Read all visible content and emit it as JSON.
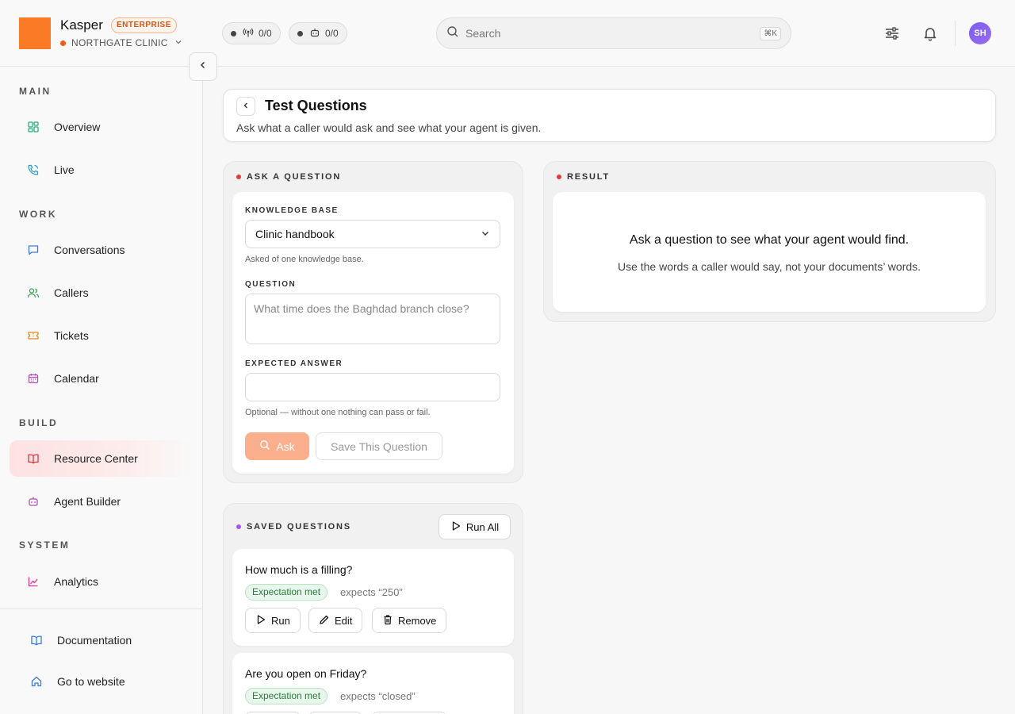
{
  "brand": {
    "name": "Kasper",
    "badge": "ENTERPRISE",
    "org": "NORTHGATE CLINIC"
  },
  "status_pills": [
    {
      "icon": "broadcast-icon",
      "value": "0/0"
    },
    {
      "icon": "bot-icon",
      "value": "0/0"
    }
  ],
  "search": {
    "placeholder": "Search",
    "shortcut": "⌘K"
  },
  "user": {
    "initials": "SH"
  },
  "sidebar": {
    "sections": [
      "MAIN",
      "WORK",
      "BUILD",
      "SYSTEM"
    ],
    "items": [
      {
        "label": "Overview",
        "icon": "grid-icon"
      },
      {
        "label": "Live",
        "icon": "phone-icon"
      },
      {
        "label": "Conversations",
        "icon": "chat-icon"
      },
      {
        "label": "Callers",
        "icon": "users-icon"
      },
      {
        "label": "Tickets",
        "icon": "ticket-icon"
      },
      {
        "label": "Calendar",
        "icon": "calendar-icon"
      },
      {
        "label": "Resource Center",
        "icon": "book-icon",
        "active": true
      },
      {
        "label": "Agent Builder",
        "icon": "bot-icon"
      },
      {
        "label": "Analytics",
        "icon": "chart-icon"
      }
    ],
    "bottom": [
      {
        "label": "Documentation",
        "icon": "book-icon"
      },
      {
        "label": "Go to website",
        "icon": "home-icon"
      }
    ]
  },
  "page": {
    "title": "Test Questions",
    "subtitle": "Ask what a caller would ask and see what your agent is given."
  },
  "ask": {
    "section_label": "ASK A QUESTION",
    "kb_label": "KNOWLEDGE BASE",
    "kb_value": "Clinic handbook",
    "kb_hint": "Asked of one knowledge base.",
    "question_label": "QUESTION",
    "question_placeholder": "What time does the Baghdad branch close?",
    "expected_label": "EXPECTED ANSWER",
    "expected_value": "",
    "expected_hint": "Optional — without one nothing can pass or fail.",
    "ask_button": "Ask",
    "save_button": "Save This Question"
  },
  "result": {
    "section_label": "RESULT",
    "empty_title": "Ask a question to see what your agent would find.",
    "empty_sub": "Use the words a caller would say, not your documents’ words."
  },
  "saved": {
    "section_label": "SAVED QUESTIONS",
    "run_all": "Run All",
    "items": [
      {
        "question": "How much is a filling?",
        "status": "Expectation met",
        "expects": "expects “250”"
      },
      {
        "question": "Are you open on Friday?",
        "status": "Expectation met",
        "expects": "expects “closed”"
      }
    ],
    "actions": {
      "run": "Run",
      "edit": "Edit",
      "remove": "Remove"
    }
  },
  "colors": {
    "accent": "#fb7a26",
    "active_bg": "#fde2e2",
    "success": "#2d7a3e"
  }
}
